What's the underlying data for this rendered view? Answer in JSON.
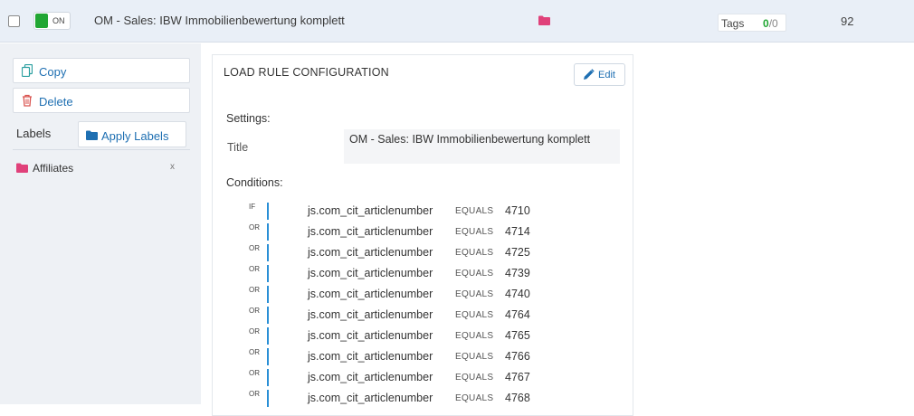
{
  "row": {
    "status": "ON",
    "title": "OM - Sales: IBW Immobilienbewertung komplett",
    "tags_label": "Tags",
    "tags_active": "0",
    "tags_separator": "/",
    "tags_total": "0",
    "number": "92"
  },
  "sidebar": {
    "copy_label": "Copy",
    "delete_label": "Delete",
    "labels_heading": "Labels",
    "apply_labels": "Apply Labels",
    "label_items": [
      {
        "name": "Affiliates",
        "remove": "x"
      }
    ]
  },
  "panel": {
    "heading": "LOAD RULE CONFIGURATION",
    "edit_label": "Edit",
    "settings_heading": "Settings:",
    "title_key": "Title",
    "title_value": "OM - Sales: IBW Immobilienbewertung komplett",
    "conditions_heading": "Conditions:",
    "conditions": [
      {
        "op": "IF",
        "variable": "js.com_cit_articlenumber",
        "comparator": "EQUALS",
        "value": "4710"
      },
      {
        "op": "OR",
        "variable": "js.com_cit_articlenumber",
        "comparator": "EQUALS",
        "value": "4714"
      },
      {
        "op": "OR",
        "variable": "js.com_cit_articlenumber",
        "comparator": "EQUALS",
        "value": "4725"
      },
      {
        "op": "OR",
        "variable": "js.com_cit_articlenumber",
        "comparator": "EQUALS",
        "value": "4739"
      },
      {
        "op": "OR",
        "variable": "js.com_cit_articlenumber",
        "comparator": "EQUALS",
        "value": "4740"
      },
      {
        "op": "OR",
        "variable": "js.com_cit_articlenumber",
        "comparator": "EQUALS",
        "value": "4764"
      },
      {
        "op": "OR",
        "variable": "js.com_cit_articlenumber",
        "comparator": "EQUALS",
        "value": "4765"
      },
      {
        "op": "OR",
        "variable": "js.com_cit_articlenumber",
        "comparator": "EQUALS",
        "value": "4766"
      },
      {
        "op": "OR",
        "variable": "js.com_cit_articlenumber",
        "comparator": "EQUALS",
        "value": "4767"
      },
      {
        "op": "OR",
        "variable": "js.com_cit_articlenumber",
        "comparator": "EQUALS",
        "value": "4768"
      }
    ]
  },
  "colors": {
    "accent": "#1e6fb2",
    "on_green": "#21a633",
    "folder_pink": "#e0417a",
    "condition_bar": "#2a8fd6",
    "delete_red": "#d9534f"
  },
  "icons": {
    "copy": "copy-icon",
    "delete": "trash-icon",
    "folder": "folder-icon",
    "edit": "pencil-icon"
  }
}
